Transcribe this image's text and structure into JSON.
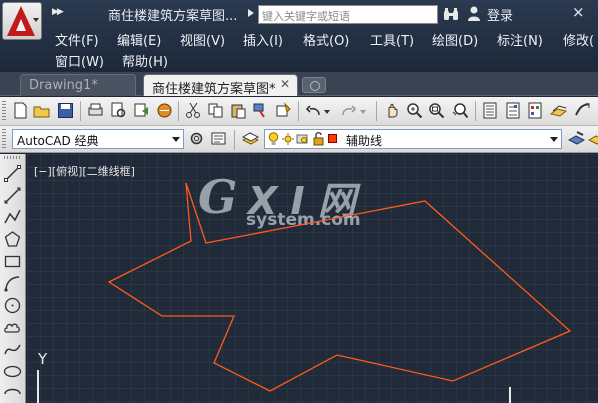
{
  "title_bar": {
    "title": "商住楼建筑方案草图...",
    "search_placeholder": "键入关键字或短语",
    "login_label": "登录",
    "close_glyph": "×"
  },
  "menu": {
    "row1": [
      "文件(F)",
      "编辑(E)",
      "视图(V)",
      "插入(I)",
      "格式(O)",
      "工具(T)",
      "绘图(D)",
      "标注(N)",
      "修改("
    ],
    "row2": [
      "窗口(W)",
      "帮助(H)"
    ]
  },
  "tabs": [
    {
      "label": "Drawing1*",
      "active": false
    },
    {
      "label": "商住楼建筑方案草图*",
      "active": true
    }
  ],
  "toolbar2": {
    "workspace": "AutoCAD 经典",
    "layer_name": "辅助线",
    "layer_color": "#ff3c00"
  },
  "viewport": {
    "label": "[−][俯视][二维线框]",
    "ucs_label": "Y"
  },
  "watermark": {
    "g": "G",
    "xi": "X I 网",
    "system": "system.com"
  },
  "drawing": {
    "stroke_color": "#ff5a1a",
    "shape": "closed-polyline"
  },
  "colors": {
    "canvas_bg": "#212a38",
    "title_bg": "#1c2838",
    "accent_red": "#c11a1a"
  }
}
